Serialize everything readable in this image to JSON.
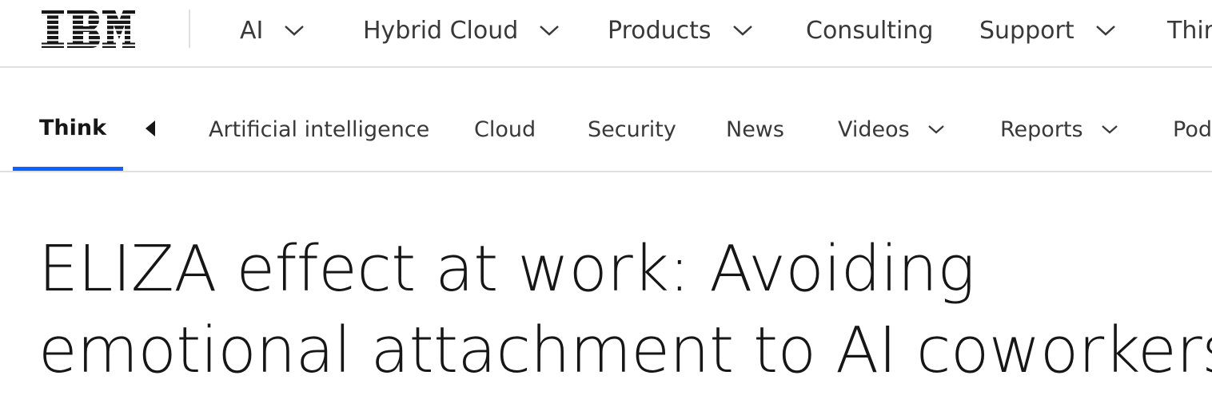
{
  "brand": {
    "logo_text": "IBM",
    "accent_color": "#0f62fe"
  },
  "top_nav": {
    "items": [
      {
        "label": "AI",
        "has_dropdown": true
      },
      {
        "label": "Hybrid Cloud",
        "has_dropdown": true
      },
      {
        "label": "Products",
        "has_dropdown": true
      },
      {
        "label": "Consulting",
        "has_dropdown": false
      },
      {
        "label": "Support",
        "has_dropdown": true
      },
      {
        "label": "Thir",
        "has_dropdown": false
      }
    ]
  },
  "sub_nav": {
    "brand_label": "Think",
    "scroll_icon": "caret-left-icon",
    "items": [
      {
        "label": "Artificial intelligence",
        "has_dropdown": false
      },
      {
        "label": "Cloud",
        "has_dropdown": false
      },
      {
        "label": "Security",
        "has_dropdown": false
      },
      {
        "label": "News",
        "has_dropdown": false
      },
      {
        "label": "Videos",
        "has_dropdown": true
      },
      {
        "label": "Reports",
        "has_dropdown": true
      },
      {
        "label": "Pod",
        "has_dropdown": false
      }
    ]
  },
  "article": {
    "title_line_1": "ELIZA effect at work: Avoiding",
    "title_line_2": "emotional attachment to AI coworkers"
  }
}
